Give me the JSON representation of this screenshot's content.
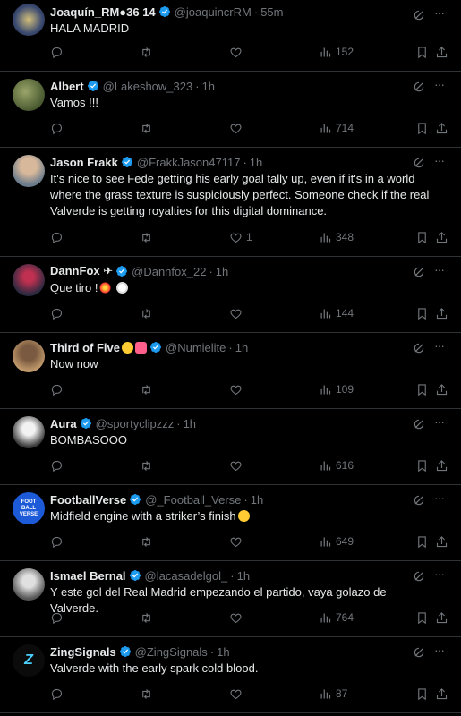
{
  "colors": {
    "background": "#000000",
    "text": "#e7e9ea",
    "muted": "#71767b",
    "verified": "#1d9bf0",
    "divider": "#2f3336"
  },
  "tweets": [
    {
      "name": "Joaquín_RM●36 14",
      "handle": "@joaquincrRM",
      "dot": "·",
      "time": "55m",
      "text": "HALA MADRID",
      "replies": "",
      "retweets": "",
      "likes": "",
      "views": "152",
      "avatar_icon": "crest-avatar"
    },
    {
      "name": "Albert",
      "handle": "@Lakeshow_323",
      "dot": "·",
      "time": "1h",
      "text": "Vamos !!!",
      "replies": "",
      "retweets": "",
      "likes": "",
      "views": "714",
      "avatar_icon": "photo-avatar"
    },
    {
      "name": "Jason Frakk",
      "handle": "@FrakkJason47117",
      "dot": "·",
      "time": "1h",
      "text": "It's nice to see Fede getting his early goal tally up, even if it's in a world where the grass texture is suspiciously perfect. Someone check if the real Valverde is getting royalties for this digital dominance.",
      "replies": "",
      "retweets": "",
      "likes": "1",
      "views": "348",
      "avatar_icon": "portrait-avatar"
    },
    {
      "name": "DannFox ✈",
      "handle": "@Dannfox_22",
      "dot": "·",
      "time": "1h",
      "text": "Que tiro !",
      "replies": "",
      "retweets": "",
      "likes": "",
      "views": "144",
      "avatar_icon": "mask-avatar"
    },
    {
      "name": "Third of Five",
      "handle": "@Numielite",
      "dot": "·",
      "time": "1h",
      "text": "Now now",
      "replies": "",
      "retweets": "",
      "likes": "",
      "views": "109",
      "avatar_icon": "person-avatar"
    },
    {
      "name": "Aura",
      "handle": "@sportyclipzzz",
      "dot": "·",
      "time": "1h",
      "text": "BOMBASOOO",
      "replies": "",
      "retweets": "",
      "likes": "",
      "views": "616",
      "avatar_icon": "player-avatar"
    },
    {
      "name": "FootballVerse",
      "handle": "@_Football_Verse",
      "dot": "·",
      "time": "1h",
      "text": "Midfield engine with a striker’s finish",
      "replies": "",
      "retweets": "",
      "likes": "",
      "views": "649",
      "avatar_icon": "footballverse-logo"
    },
    {
      "name": "Ismael Bernal",
      "handle": "@lacasadelgol_",
      "dot": "·",
      "time": "1h",
      "text": "Y este gol del Real Madrid empezando el partido, vaya golazo de Valverde.",
      "replies": "",
      "retweets": "",
      "likes": "",
      "views": "764",
      "avatar_icon": "bw-portrait-avatar"
    },
    {
      "name": "ZingSignals",
      "handle": "@ZingSignals",
      "dot": "·",
      "time": "1h",
      "text": "Valverde with the early spark   cold blood.",
      "replies": "",
      "retweets": "",
      "likes": "",
      "views": "87",
      "avatar_icon": "zing-logo"
    }
  ]
}
